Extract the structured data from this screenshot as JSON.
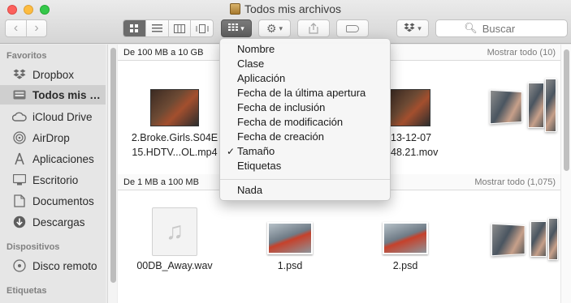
{
  "window": {
    "title": "Todos mis archivos"
  },
  "toolbar": {
    "back_label": "‹",
    "forward_label": "›",
    "search_placeholder": "Buscar"
  },
  "sidebar": {
    "favorites_header": "Favoritos",
    "devices_header": "Dispositivos",
    "tags_header": "Etiquetas",
    "items": [
      {
        "label": "Dropbox",
        "icon": "dropbox-icon"
      },
      {
        "label": "Todos mis archivos",
        "icon": "all-files-icon",
        "selected": true
      },
      {
        "label": "iCloud Drive",
        "icon": "cloud-icon"
      },
      {
        "label": "AirDrop",
        "icon": "airdrop-icon"
      },
      {
        "label": "Aplicaciones",
        "icon": "applications-icon"
      },
      {
        "label": "Escritorio",
        "icon": "desktop-icon"
      },
      {
        "label": "Documentos",
        "icon": "documents-icon"
      },
      {
        "label": "Descargas",
        "icon": "downloads-icon"
      }
    ],
    "devices": [
      {
        "label": "Disco remoto",
        "icon": "disc-icon"
      }
    ]
  },
  "groups": [
    {
      "title": "De 100 MB a 10 GB",
      "more": "Mostrar todo (10)",
      "files": [
        {
          "name_line1": "2.Broke.Girls.S04E",
          "name_line2": "15.HDTV...OL.mp4"
        },
        {
          "name_line1": "13-12-07",
          "name_line2": "48.21.mov"
        }
      ]
    },
    {
      "title": "De 1 MB a 100 MB",
      "more": "Mostrar todo (1,075)",
      "files": [
        {
          "name": "00DB_Away.wav"
        },
        {
          "name": "1.psd"
        },
        {
          "name": "2.psd"
        }
      ]
    }
  ],
  "arrange_menu": {
    "items": [
      {
        "label": "Nombre",
        "checked": false
      },
      {
        "label": "Clase",
        "checked": false
      },
      {
        "label": "Aplicación",
        "checked": false
      },
      {
        "label": "Fecha de la última apertura",
        "checked": false
      },
      {
        "label": "Fecha de inclusión",
        "checked": false
      },
      {
        "label": "Fecha de modificación",
        "checked": false
      },
      {
        "label": "Fecha de creación",
        "checked": false
      },
      {
        "label": "Tamaño",
        "checked": true
      },
      {
        "label": "Etiquetas",
        "checked": false
      }
    ],
    "none_label": "Nada"
  }
}
